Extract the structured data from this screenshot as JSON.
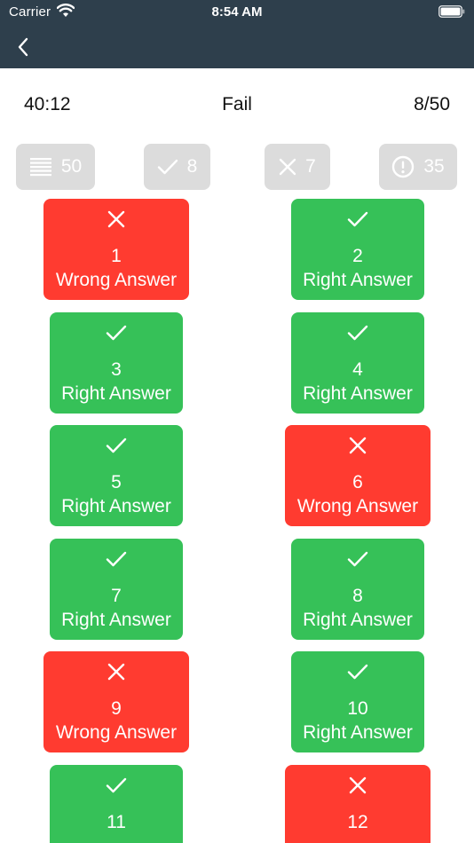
{
  "status_bar": {
    "carrier": "Carrier",
    "time": "8:54 AM"
  },
  "nav": {
    "back_icon": "chevron-left-icon"
  },
  "summary": {
    "elapsed_time": "40:12",
    "result": "Fail",
    "score": "8/50"
  },
  "filters": [
    {
      "icon": "list-icon",
      "count": "50"
    },
    {
      "icon": "checkmark-icon",
      "count": "8"
    },
    {
      "icon": "cross-icon",
      "count": "7"
    },
    {
      "icon": "exclamation-circle-icon",
      "count": "35"
    }
  ],
  "colors": {
    "header": "#2e3f4c",
    "right": "#36c158",
    "wrong": "#ff3b30",
    "chip": "#dcdcdc"
  },
  "questions": [
    {
      "number": "1",
      "status": "wrong",
      "label": "Wrong Answer"
    },
    {
      "number": "2",
      "status": "right",
      "label": "Right Answer"
    },
    {
      "number": "3",
      "status": "right",
      "label": "Right Answer"
    },
    {
      "number": "4",
      "status": "right",
      "label": "Right Answer"
    },
    {
      "number": "5",
      "status": "right",
      "label": "Right Answer"
    },
    {
      "number": "6",
      "status": "wrong",
      "label": "Wrong Answer"
    },
    {
      "number": "7",
      "status": "right",
      "label": "Right Answer"
    },
    {
      "number": "8",
      "status": "right",
      "label": "Right Answer"
    },
    {
      "number": "9",
      "status": "wrong",
      "label": "Wrong Answer"
    },
    {
      "number": "10",
      "status": "right",
      "label": "Right Answer"
    },
    {
      "number": "11",
      "status": "right",
      "label": ""
    },
    {
      "number": "12",
      "status": "wrong",
      "label": ""
    }
  ]
}
